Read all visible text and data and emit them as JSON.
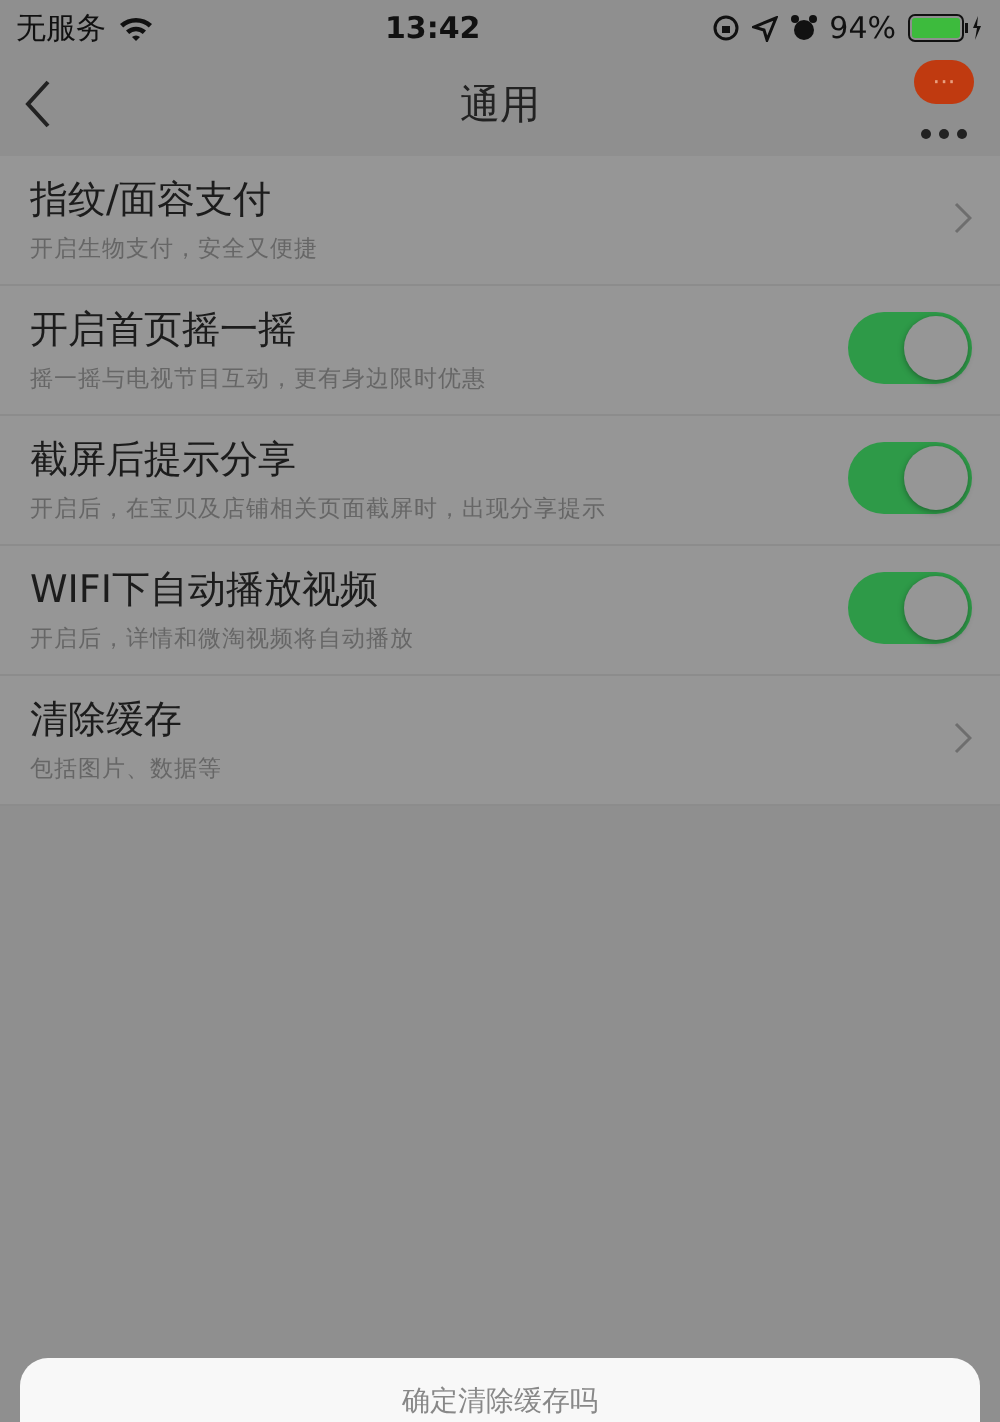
{
  "status_bar": {
    "carrier": "无服务",
    "time": "13:42",
    "battery": "94%"
  },
  "nav": {
    "title": "通用",
    "badge": "···"
  },
  "settings": [
    {
      "kind": "link",
      "title": "指纹/面容支付",
      "subtitle": "开启生物支付，安全又便捷"
    },
    {
      "kind": "toggle",
      "title": "开启首页摇一摇",
      "subtitle": "摇一摇与电视节目互动，更有身边限时优惠",
      "on": true
    },
    {
      "kind": "toggle",
      "title": "截屏后提示分享",
      "subtitle": "开启后，在宝贝及店铺相关页面截屏时，出现分享提示",
      "on": true
    },
    {
      "kind": "toggle",
      "title": "WIFI下自动播放视频",
      "subtitle": "开启后，详情和微淘视频将自动播放",
      "on": true
    },
    {
      "kind": "link",
      "title": "清除缓存",
      "subtitle": "包括图片、数据等"
    }
  ],
  "dialog": {
    "title": "确定清除缓存吗"
  }
}
